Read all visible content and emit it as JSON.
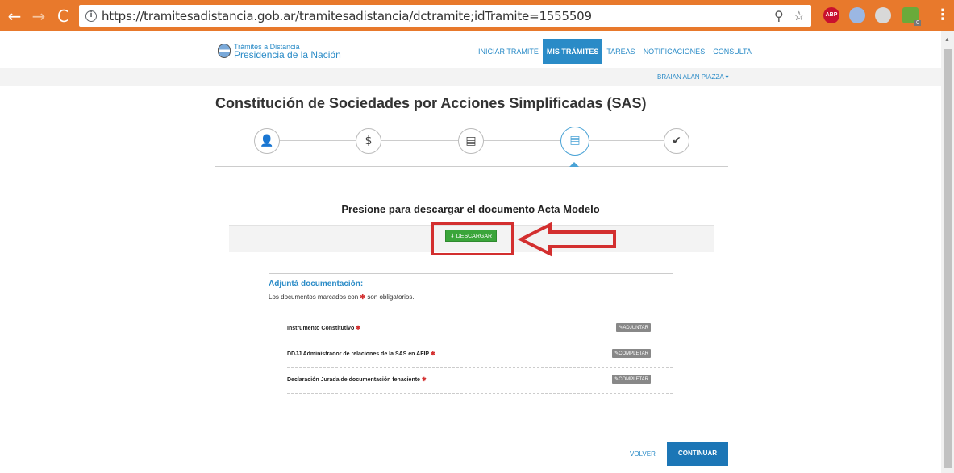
{
  "browser": {
    "url": "https://tramitesadistancia.gob.ar/tramitesadistancia/dctramite;idTramite=1555509",
    "back_icon": "←",
    "forward_icon": "→",
    "reload_icon": "C",
    "info_icon": "i",
    "zoom_icon": "⚲",
    "star_icon": "☆",
    "abp_label": "ABP",
    "ext_badge": "0",
    "menu_icon": "⋮"
  },
  "header": {
    "logo_small": "Trámites a Distancia",
    "logo_big": "Presidencia de la Nación",
    "nav": [
      {
        "label": "INICIAR TRÁMITE"
      },
      {
        "label": "MIS TRÁMITES",
        "active": true
      },
      {
        "label": "TAREAS"
      },
      {
        "label": "NOTIFICACIONES"
      },
      {
        "label": "CONSULTA"
      }
    ],
    "user": "BRAIAN ALAN PIAZZA ▾"
  },
  "main": {
    "title": "Constitución de Sociedades por Acciones Simplificadas (SAS)",
    "steps": [
      {
        "icon": "user-icon",
        "glyph": "👤"
      },
      {
        "icon": "dollar-icon",
        "glyph": "$"
      },
      {
        "icon": "form-icon",
        "glyph": "▤"
      },
      {
        "icon": "form-icon",
        "glyph": "▤",
        "active": true
      },
      {
        "icon": "check-icon",
        "glyph": "✔"
      }
    ],
    "download_title": "Presione para descargar el documento Acta Modelo",
    "download_button": "⬇ DESCARGAR",
    "docs_title": "Adjuntá documentación:",
    "docs_note_before": "Los documentos marcados con",
    "docs_note_star": "✱",
    "docs_note_after": "son obligatorios.",
    "documents": [
      {
        "label": "Instrumento Constitutivo",
        "required": "✱",
        "action": "✎ADJUNTAR"
      },
      {
        "label": "DDJJ Administrador de relaciones de la SAS en AFIP",
        "required": "✱",
        "action": "✎COMPLETAR"
      },
      {
        "label": "Declaración Jurada de documentación fehaciente",
        "required": "✱",
        "action": "✎COMPLETAR"
      }
    ],
    "back_label": "VOLVER",
    "continue_label": "CONTINUAR"
  },
  "colors": {
    "chrome": "#e8792c",
    "brand_blue": "#2a8bc7",
    "download_green": "#3aa53a",
    "highlight_red": "#d32f2f",
    "continue_blue": "#1c76b6"
  }
}
